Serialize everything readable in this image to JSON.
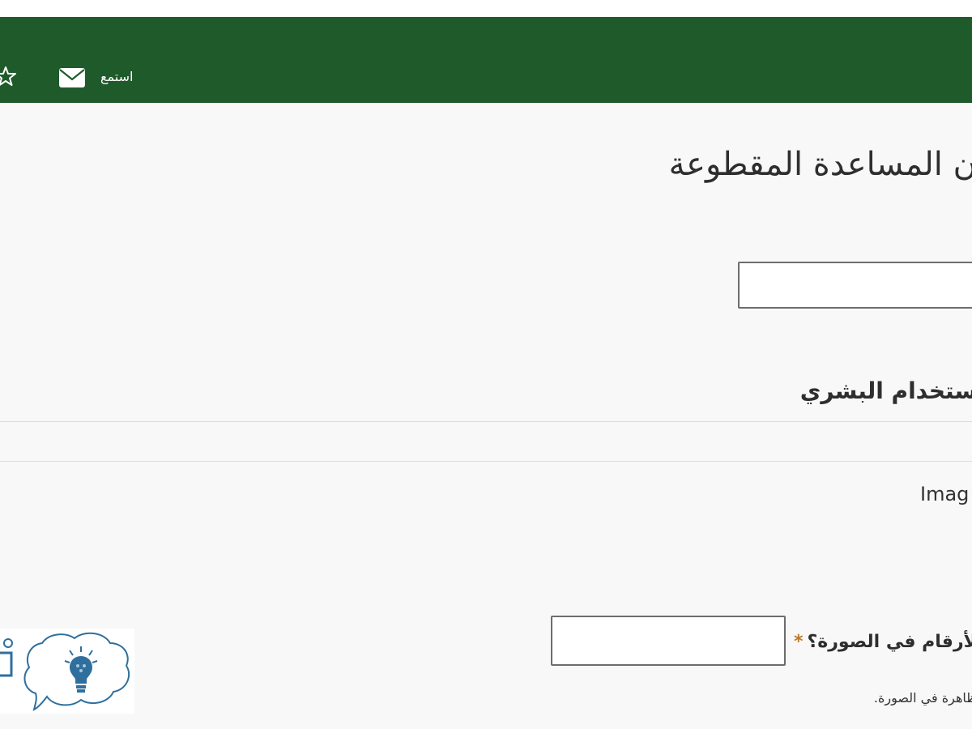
{
  "header": {
    "listen_label": "استمع",
    "icons": [
      "star-icon",
      "mail-icon"
    ]
  },
  "page": {
    "title": "ن المساعدة المقطوعة"
  },
  "form": {
    "name_input_value": "",
    "section_heading": "ستخدام البشري",
    "image_label": "Imag",
    "captcha_question": "لأرقام في الصورة؟",
    "required_mark": "*",
    "captcha_input_value": "",
    "captcha_help": "ظاهرة في الصورة."
  },
  "logo": {
    "icons": [
      "lightbulb-icon",
      "speech-bubble-icon"
    ]
  },
  "colors": {
    "header_bg": "#1f5a2b",
    "content_bg": "#f8f8f8",
    "required": "#c2772a",
    "logo_blue": "#2f6f9e"
  }
}
